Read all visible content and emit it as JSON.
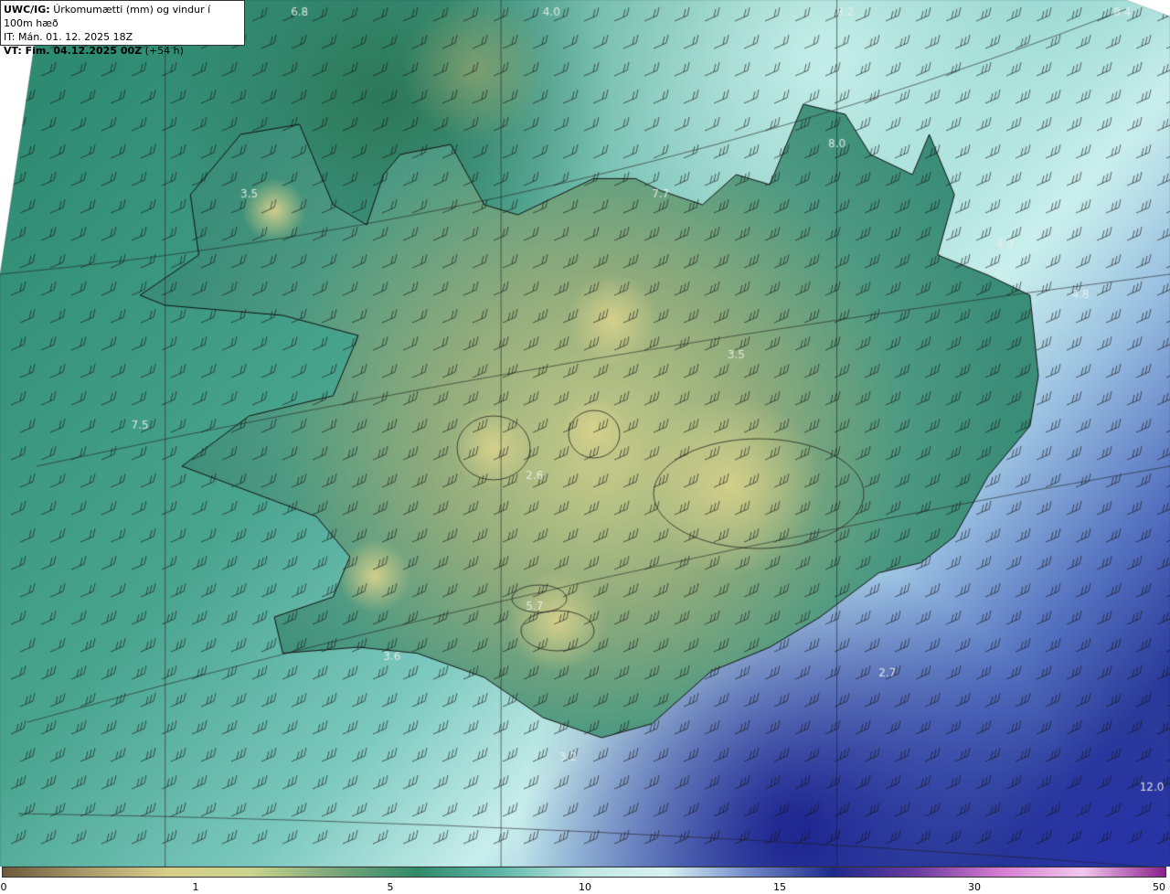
{
  "header": {
    "model": "UWC/IG:",
    "description": "Úrkomumætti (mm) og vindur í 100m hæð",
    "it_line": "IT: Mán. 01. 12. 2025 18Z",
    "vt_prefix": "VT: Fim. 04.12.2025 00Z",
    "vt_suffix": "(+54 h)"
  },
  "colorbar": {
    "ticks": [
      "0",
      "1",
      "5",
      "10",
      "15",
      "30",
      "50"
    ],
    "colors": [
      "#6b5a3a",
      "#a9996a",
      "#d8cf8a",
      "#c9d48c",
      "#7aa57a",
      "#2f8a6a",
      "#5fb7a8",
      "#bfe8e4",
      "#d9f2f3",
      "#6f86c8",
      "#1d2a8a",
      "#6a3aa0",
      "#d67bd0",
      "#f2c8f0",
      "#8a1f8a"
    ]
  },
  "labels": [
    {
      "text": "4.0",
      "lon": -19.4,
      "lat": 67.55
    },
    {
      "text": "6.8",
      "lon": -22.4,
      "lat": 67.15
    },
    {
      "text": "8.2",
      "lon": -15.9,
      "lat": 67.75
    },
    {
      "text": "3.5",
      "lon": -23.0,
      "lat": 66.1
    },
    {
      "text": "7.7",
      "lon": -18.1,
      "lat": 66.1
    },
    {
      "text": "8.0",
      "lon": -16.0,
      "lat": 66.35
    },
    {
      "text": "4.9",
      "lon": -14.0,
      "lat": 65.85
    },
    {
      "text": "4.8",
      "lon": -13.1,
      "lat": 65.6
    },
    {
      "text": "3.5",
      "lon": -17.2,
      "lat": 65.3
    },
    {
      "text": "7.5",
      "lon": -24.3,
      "lat": 64.95
    },
    {
      "text": "2.6",
      "lon": -19.6,
      "lat": 64.7
    },
    {
      "text": "5.7",
      "lon": -19.6,
      "lat": 64.05
    },
    {
      "text": "3.6",
      "lon": -21.3,
      "lat": 63.8
    },
    {
      "text": "2.7",
      "lon": -15.4,
      "lat": 63.72
    },
    {
      "text": "3.2",
      "lon": -19.2,
      "lat": 63.3
    },
    {
      "text": "12.0",
      "lon": -10.6,
      "lat": 63.15
    },
    {
      "text": "8.4",
      "lon": -12.6,
      "lat": 68.2
    }
  ]
}
